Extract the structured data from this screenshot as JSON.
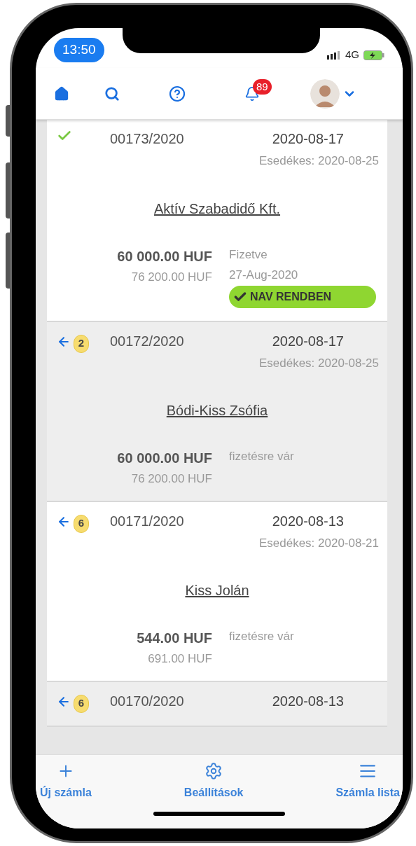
{
  "status_bar": {
    "time": "13:50",
    "network": "4G"
  },
  "header": {
    "notification_count": "89"
  },
  "invoices": [
    {
      "kind": "paid",
      "shaded": false,
      "number": "00173/2020",
      "date": "2020-08-17",
      "due": "Esedékes: 2020-08-25",
      "customer": "Aktív Szabadidő Kft.",
      "net": "60 000.00 HUF",
      "gross": "76 200.00 HUF",
      "status": "Fizetve",
      "paid_date": "27-Aug-2020",
      "nav_badge": "NAV RENDBEN"
    },
    {
      "kind": "returned",
      "shaded": true,
      "count": "2",
      "number": "00172/2020",
      "date": "2020-08-17",
      "due": "Esedékes: 2020-08-25",
      "customer": "Bódi-Kiss Zsófia",
      "net": "60 000.00 HUF",
      "gross": "76 200.00 HUF",
      "status": "fizetésre vár"
    },
    {
      "kind": "returned",
      "shaded": false,
      "count": "6",
      "number": "00171/2020",
      "date": "2020-08-13",
      "due": "Esedékes: 2020-08-21",
      "customer": "Kiss Jolán",
      "net": "544.00 HUF",
      "gross": "691.00 HUF",
      "status": "fizetésre vár"
    },
    {
      "kind": "returned",
      "shaded": true,
      "count": "6",
      "number": "00170/2020",
      "date": "2020-08-13"
    }
  ],
  "tab_bar": [
    {
      "kind": "add",
      "label": "Új számla"
    },
    {
      "kind": "settings",
      "label": "Beállítások"
    },
    {
      "kind": "list",
      "label": "Számla lista"
    }
  ]
}
